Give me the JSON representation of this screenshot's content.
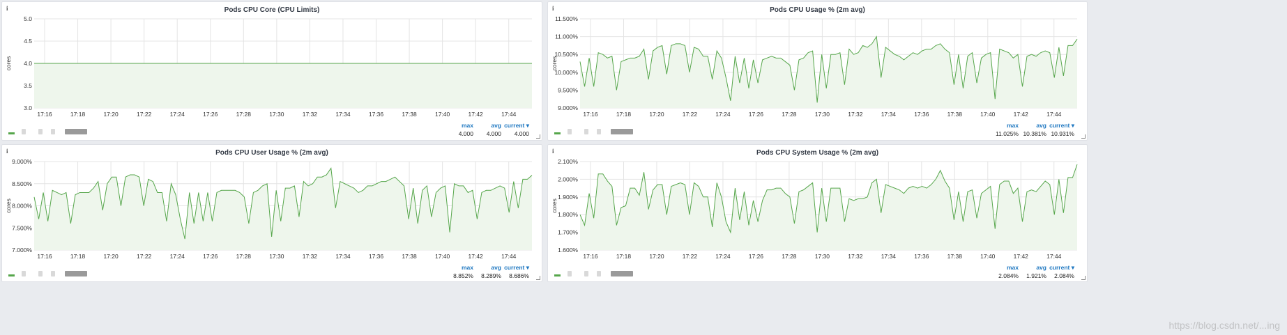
{
  "panels": [
    {
      "title": "Pods CPU Core (CPU Limits)",
      "ylabel": "cores",
      "yticks": [
        "5.0",
        "4.5",
        "4.0",
        "3.5",
        "3.0"
      ],
      "xticks": [
        "17:16",
        "17:18",
        "17:20",
        "17:22",
        "17:24",
        "17:26",
        "17:28",
        "17:30",
        "17:32",
        "17:34",
        "17:36",
        "17:38",
        "17:40",
        "17:42",
        "17:44"
      ],
      "legend": {
        "max_label": "max",
        "avg_label": "avg",
        "current_label": "current ▾",
        "max": "4.000",
        "avg": "4.000",
        "current": "4.000"
      }
    },
    {
      "title": "Pods CPU Usage % (2m avg)",
      "ylabel": "cores",
      "yticks": [
        "11.500%",
        "11.000%",
        "10.500%",
        "10.000%",
        "9.500%",
        "9.000%"
      ],
      "xticks": [
        "17:16",
        "17:18",
        "17:20",
        "17:22",
        "17:24",
        "17:26",
        "17:28",
        "17:30",
        "17:32",
        "17:34",
        "17:36",
        "17:38",
        "17:40",
        "17:42",
        "17:44"
      ],
      "legend": {
        "max_label": "max",
        "avg_label": "avg",
        "current_label": "current ▾",
        "max": "11.025%",
        "avg": "10.381%",
        "current": "10.931%"
      }
    },
    {
      "title": "Pods CPU User Usage % (2m avg)",
      "ylabel": "cores",
      "yticks": [
        "9.000%",
        "8.500%",
        "8.000%",
        "7.500%",
        "7.000%"
      ],
      "xticks": [
        "17:16",
        "17:18",
        "17:20",
        "17:22",
        "17:24",
        "17:26",
        "17:28",
        "17:30",
        "17:32",
        "17:34",
        "17:36",
        "17:38",
        "17:40",
        "17:42",
        "17:44"
      ],
      "legend": {
        "max_label": "max",
        "avg_label": "avg",
        "current_label": "current ▾",
        "max": "8.852%",
        "avg": "8.289%",
        "current": "8.686%"
      }
    },
    {
      "title": "Pods CPU System Usage % (2m avg)",
      "ylabel": "cores",
      "yticks": [
        "2.100%",
        "2.000%",
        "1.900%",
        "1.800%",
        "1.700%",
        "1.600%"
      ],
      "xticks": [
        "17:16",
        "17:18",
        "17:20",
        "17:22",
        "17:24",
        "17:26",
        "17:28",
        "17:30",
        "17:32",
        "17:34",
        "17:36",
        "17:38",
        "17:40",
        "17:42",
        "17:44"
      ],
      "legend": {
        "max_label": "max",
        "avg_label": "avg",
        "current_label": "current ▾",
        "max": "2.084%",
        "avg": "1.921%",
        "current": "2.084%"
      }
    }
  ],
  "info_icon": "i",
  "colors": {
    "series": "#56a64b",
    "fill": "#eef6ec",
    "grid": "#e4e4e4",
    "legend_head": "#1f78c1"
  },
  "watermark": "https://blog.csdn.net/...ing",
  "chart_data": [
    {
      "type": "line",
      "title": "Pods CPU Core (CPU Limits)",
      "xlabel": "",
      "ylabel": "cores",
      "ylim": [
        3.0,
        5.0
      ],
      "x": [
        "17:15",
        "17:45"
      ],
      "series": [
        {
          "values": [
            4.0,
            4.0
          ]
        }
      ]
    },
    {
      "type": "line",
      "title": "Pods CPU Usage % (2m avg)",
      "xlabel": "",
      "ylabel": "cores",
      "ylim": [
        9.0,
        11.5
      ],
      "series": [
        {
          "values": [
            10.3,
            9.6,
            10.4,
            9.6,
            10.55,
            10.5,
            10.4,
            10.45,
            9.5,
            10.3,
            10.35,
            10.4,
            10.4,
            10.45,
            10.65,
            9.8,
            10.6,
            10.7,
            10.75,
            9.95,
            10.75,
            10.8,
            10.8,
            10.75,
            10.0,
            10.7,
            10.65,
            10.45,
            10.45,
            9.8,
            10.6,
            10.4,
            9.85,
            9.2,
            10.45,
            9.7,
            10.4,
            9.55,
            10.35,
            9.7,
            10.35,
            10.4,
            10.45,
            10.4,
            10.4,
            10.3,
            10.2,
            9.5,
            10.35,
            10.4,
            10.55,
            10.6,
            9.15,
            10.5,
            9.55,
            10.5,
            10.5,
            10.55,
            9.65,
            10.65,
            10.5,
            10.55,
            10.75,
            10.7,
            10.8,
            11.0,
            9.85,
            10.7,
            10.6,
            10.5,
            10.45,
            10.35,
            10.45,
            10.55,
            10.5,
            10.6,
            10.65,
            10.65,
            10.75,
            10.8,
            10.65,
            10.55,
            9.65,
            10.5,
            9.55,
            10.45,
            10.55,
            9.7,
            10.4,
            10.5,
            10.55,
            9.25,
            10.65,
            10.6,
            10.55,
            10.4,
            10.5,
            9.6,
            10.45,
            10.5,
            10.45,
            10.55,
            10.6,
            10.55,
            9.85,
            10.7,
            9.9,
            10.75,
            10.75,
            10.93
          ]
        }
      ]
    },
    {
      "type": "line",
      "title": "Pods CPU User Usage % (2m avg)",
      "xlabel": "",
      "ylabel": "cores",
      "ylim": [
        7.0,
        9.0
      ],
      "series": [
        {
          "values": [
            8.2,
            7.7,
            8.3,
            7.65,
            8.35,
            8.3,
            8.25,
            8.3,
            7.6,
            8.25,
            8.3,
            8.3,
            8.3,
            8.4,
            8.55,
            7.9,
            8.5,
            8.65,
            8.65,
            8.0,
            8.65,
            8.7,
            8.7,
            8.65,
            8.0,
            8.6,
            8.55,
            8.3,
            8.3,
            7.65,
            8.5,
            8.25,
            7.7,
            7.25,
            8.3,
            7.6,
            8.3,
            7.65,
            8.3,
            7.65,
            8.3,
            8.35,
            8.35,
            8.35,
            8.35,
            8.3,
            8.2,
            7.6,
            8.3,
            8.35,
            8.45,
            8.5,
            7.3,
            8.35,
            7.65,
            8.4,
            8.4,
            8.45,
            7.75,
            8.55,
            8.45,
            8.5,
            8.65,
            8.65,
            8.7,
            8.85,
            7.95,
            8.55,
            8.5,
            8.45,
            8.4,
            8.3,
            8.35,
            8.45,
            8.45,
            8.5,
            8.55,
            8.55,
            8.6,
            8.65,
            8.55,
            8.45,
            7.7,
            8.4,
            7.6,
            8.35,
            8.45,
            7.75,
            8.3,
            8.4,
            8.45,
            7.4,
            8.5,
            8.45,
            8.45,
            8.3,
            8.35,
            7.7,
            8.3,
            8.35,
            8.35,
            8.4,
            8.45,
            8.4,
            7.85,
            8.55,
            7.95,
            8.6,
            8.6,
            8.69
          ]
        }
      ]
    },
    {
      "type": "line",
      "title": "Pods CPU System Usage % (2m avg)",
      "xlabel": "",
      "ylabel": "cores",
      "ylim": [
        1.6,
        2.1
      ],
      "series": [
        {
          "values": [
            1.8,
            1.74,
            1.92,
            1.78,
            2.03,
            2.03,
            1.99,
            1.96,
            1.74,
            1.84,
            1.85,
            1.95,
            1.95,
            1.91,
            2.04,
            1.83,
            1.94,
            1.97,
            1.97,
            1.8,
            1.96,
            1.97,
            1.98,
            1.97,
            1.8,
            1.98,
            1.96,
            1.9,
            1.9,
            1.73,
            1.98,
            1.9,
            1.76,
            1.7,
            1.95,
            1.77,
            1.93,
            1.74,
            1.88,
            1.76,
            1.88,
            1.94,
            1.94,
            1.95,
            1.95,
            1.92,
            1.9,
            1.75,
            1.93,
            1.94,
            1.96,
            1.98,
            1.7,
            1.95,
            1.76,
            1.95,
            1.95,
            1.95,
            1.76,
            1.89,
            1.88,
            1.89,
            1.89,
            1.9,
            1.98,
            2.0,
            1.81,
            1.97,
            1.96,
            1.95,
            1.94,
            1.92,
            1.95,
            1.96,
            1.95,
            1.96,
            1.95,
            1.97,
            2.0,
            2.05,
            1.99,
            1.95,
            1.77,
            1.93,
            1.76,
            1.93,
            1.94,
            1.78,
            1.92,
            1.94,
            1.96,
            1.72,
            1.97,
            1.99,
            1.99,
            1.92,
            1.95,
            1.76,
            1.93,
            1.94,
            1.93,
            1.96,
            1.99,
            1.97,
            1.8,
            2.0,
            1.81,
            2.01,
            2.01,
            2.084
          ]
        }
      ]
    }
  ]
}
